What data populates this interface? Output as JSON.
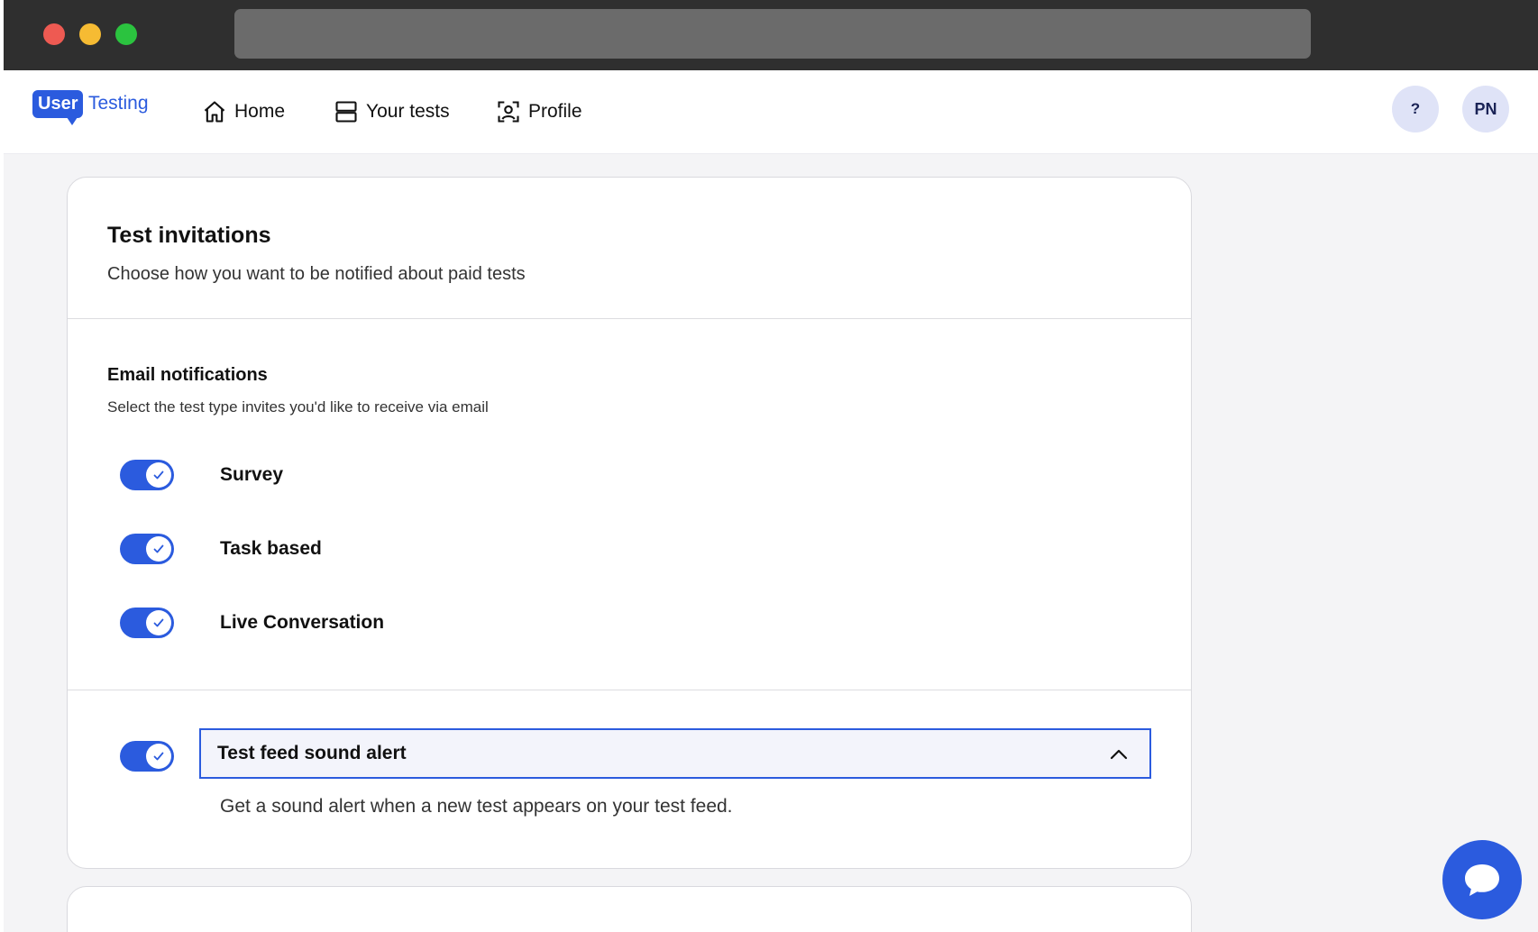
{
  "header": {
    "logo": {
      "part1": "User",
      "part2": "Testing"
    },
    "nav": [
      {
        "label": "Home",
        "icon": "home-icon"
      },
      {
        "label": "Your tests",
        "icon": "tests-icon"
      },
      {
        "label": "Profile",
        "icon": "profile-icon"
      }
    ],
    "help_label": "?",
    "avatar_initials": "PN"
  },
  "card": {
    "title": "Test invitations",
    "subtitle": "Choose how you want to be notified about paid tests",
    "email_section": {
      "title": "Email notifications",
      "subtitle": "Select the test type invites you'd like to receive via email",
      "options": [
        {
          "label": "Survey",
          "enabled": true
        },
        {
          "label": "Task based",
          "enabled": true
        },
        {
          "label": "Live Conversation",
          "enabled": true
        }
      ]
    },
    "sound_alert": {
      "label": "Test feed sound alert",
      "enabled": true,
      "expanded": true,
      "description": "Get a sound alert when a new test appears on your test feed."
    }
  },
  "colors": {
    "accent": "#2b5bde",
    "avatar_bg": "#dfe3f7",
    "page_bg": "#f4f4f6"
  }
}
